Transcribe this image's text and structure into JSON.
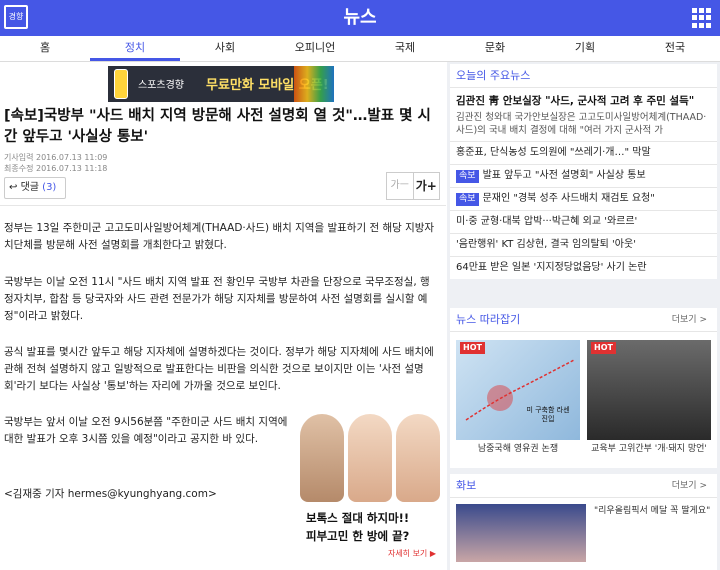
{
  "app": {
    "title": "뉴스",
    "logo_text": "경향"
  },
  "nav": {
    "tabs": [
      "홈",
      "정치",
      "사회",
      "오피니언",
      "국제",
      "문화",
      "기획",
      "전국"
    ],
    "active_index": 1
  },
  "banner": {
    "brand": "스포츠경향",
    "headline": "무료만화 모바일 오픈!"
  },
  "article": {
    "title": "[속보]국방부 \"사드 배치 지역 방문해 사전 설명회 열 것\"…발표 몇 시간 앞두고 '사실상 통보'",
    "published": "기사입력 2016.07.13 11:09",
    "modified": "최종수정 2016.07.13 11:18",
    "comment_label": "댓글",
    "comment_count": "(3)",
    "font_small": "가ㅡ",
    "font_large": "가+",
    "paragraphs": [
      "정부는 13일 주한미군 고고도미사일방어체계(THAAD·사드) 배치 지역을 발표하기 전 해당 지방자치단체를 방문해 사전 설명회를 개최한다고 밝혔다.",
      "국방부는 이날 오전 11시 \"사드 배치 지역 발표 전 황인무 국방부 차관을 단장으로 국무조정실, 행정자치부, 합참 등 당국자와 사드 관련 전문가가 해당 지자체를 방문하여 사전 설명회를 실시할 예정\"이라고 밝혔다.",
      "공식 발표를 몇시간 앞두고 해당 지자체에 설명하겠다는 것이다. 정부가 해당 지자체에 사드 배치에 관해 전혀 설명하지 않고 일방적으로 발표한다는 비판을 의식한 것으로 보이지만 이는 '사전 설명회'라기 보다는 사실상 '통보'하는 자리에 가까울 것으로 보인다.",
      "국방부는 앞서 이날 오전 9시56분쯤 \"주한미군 사드 배치 지역에 대한 발표가 오후 3시쯤 있을 예정\"이라고 공지한 바 있다.",
      "<김재중 기자 hermes@kyunghyang.com>"
    ]
  },
  "ad": {
    "line1": "보톡스 절대 하지마!!",
    "line2": "피부고민 한 방에 끝?",
    "cta": "자세히 보기 ▶"
  },
  "sidebar": {
    "main_news": {
      "header": "오늘의 주요뉴스",
      "headline": "김관진 靑 안보실장 \"사드, 군사적 고려 후 주민 설득\"",
      "summary": "김관진 청와대 국가안보실장은 고고도미사일방어체계(THAAD·사드)의 국내 배치 결정에 대해 \"여러 가지 군사적 가",
      "items": [
        {
          "tag": "",
          "text": "홍준표, 단식농성 도의원에 \"쓰레기·개…\" 막말"
        },
        {
          "tag": "속보",
          "text": "발표 앞두고 \"사전 설명회\" 사실상 통보"
        },
        {
          "tag": "속보",
          "text": "문재인 \"경북 성주 사드배치 재검토 요청\""
        },
        {
          "tag": "",
          "text": "미·중 균형·대북 압박···박근혜 외교 '와르르'"
        },
        {
          "tag": "",
          "text": "'음란행위' KT 김상현, 결국 임의탈퇴 '아웃'"
        },
        {
          "tag": "",
          "text": "64만표 받은 일본 '지지정당없음당' 사기 논란"
        }
      ]
    },
    "follow": {
      "header": "뉴스 따라잡기",
      "more": "더보기 >",
      "hot": "HOT",
      "map_label": "미 구축함 라센 진입",
      "captions": [
        "남중국해 영유권 논쟁",
        "교육부 고위간부 '개·돼지 망언'"
      ]
    },
    "photo": {
      "header": "화보",
      "more": "더보기 >",
      "caption": "\"리우올림픽서 메달 꼭 딸게요\""
    }
  }
}
